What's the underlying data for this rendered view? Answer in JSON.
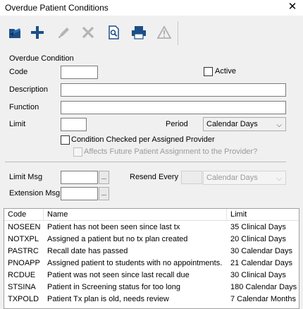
{
  "window": {
    "title": "Overdue Patient Conditions",
    "close_glyph": "✕"
  },
  "toolbar": {
    "buttons": [
      {
        "name": "open-icon"
      },
      {
        "name": "add-icon"
      },
      {
        "name": "edit-icon"
      },
      {
        "name": "delete-icon"
      },
      {
        "name": "preview-icon"
      },
      {
        "name": "print-icon"
      },
      {
        "name": "warning-icon"
      }
    ]
  },
  "form": {
    "group_label": "Overdue Condition",
    "code_label": "Code",
    "code_value": "",
    "active_label": "Active",
    "description_label": "Description",
    "description_value": "",
    "function_label": "Function",
    "function_value": "",
    "limit_label": "Limit",
    "limit_value": "",
    "period_label": "Period",
    "period_value": "Calendar Days",
    "condition_checked_label": "Condition Checked per Assigned Provider",
    "affects_future_label": "Affects Future Patient Assignment to the Provider?",
    "limit_msg_label": "Limit Msg",
    "resend_every_label": "Resend Every",
    "resend_period_value": "Calendar Days",
    "extension_msg_label": "Extension Msg",
    "ellipsis": "..."
  },
  "table": {
    "columns": [
      "Code",
      "Name",
      "Limit"
    ],
    "rows": [
      {
        "code": "NOSEEN",
        "name": "Patient has not been seen since last tx",
        "limit": "35 Clinical Days"
      },
      {
        "code": "NOTXPL",
        "name": "Assigned a patient but no tx plan created",
        "limit": "20 Clinical Days"
      },
      {
        "code": "PASTRC",
        "name": "Recall date has passed",
        "limit": "30 Calendar Days"
      },
      {
        "code": "PNOAPP",
        "name": "Assigned patient to students with no appointments.",
        "limit": "21 Calendar Days"
      },
      {
        "code": "RCDUE",
        "name": "Patient was not seen since last recall due",
        "limit": "30 Clinical Days"
      },
      {
        "code": "STSINA",
        "name": "Patient in Screening status for too long",
        "limit": "180 Calendar Days"
      },
      {
        "code": "TXPOLD",
        "name": "Patient Tx plan is old, needs review",
        "limit": "7 Calendar Months"
      }
    ]
  }
}
